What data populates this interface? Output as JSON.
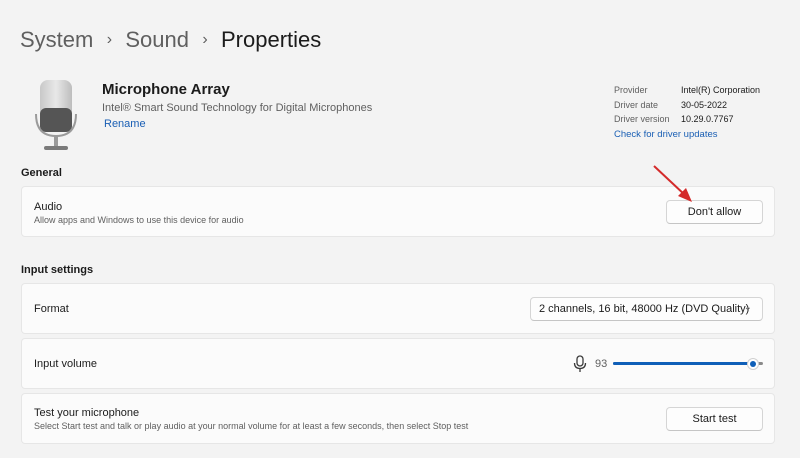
{
  "breadcrumb": {
    "items": [
      "System",
      "Sound",
      "Properties"
    ]
  },
  "device": {
    "name": "Microphone Array",
    "description": "Intel® Smart Sound Technology for Digital Microphones",
    "rename_label": "Rename",
    "icon": "microphone-icon"
  },
  "driver": {
    "provider_label": "Provider",
    "provider_value": "Intel(R) Corporation",
    "date_label": "Driver date",
    "date_value": "30-05-2022",
    "version_label": "Driver version",
    "version_value": "10.29.0.7767",
    "update_link": "Check for driver updates"
  },
  "general": {
    "title": "General",
    "audio": {
      "title": "Audio",
      "subtitle": "Allow apps and Windows to use this device for audio",
      "button": "Don't allow"
    }
  },
  "input": {
    "title": "Input settings",
    "format": {
      "title": "Format",
      "selected": "2 channels, 16 bit, 48000 Hz (DVD Quality)"
    },
    "volume": {
      "title": "Input volume",
      "value": "93",
      "level": 0.93
    },
    "test": {
      "title": "Test your microphone",
      "subtitle": "Select Start test and talk or play audio at your normal volume for at least a few seconds, then select Stop test",
      "button": "Start test"
    }
  },
  "colors": {
    "accent": "#0f5fb8",
    "annotation_arrow": "#d42a2a"
  }
}
